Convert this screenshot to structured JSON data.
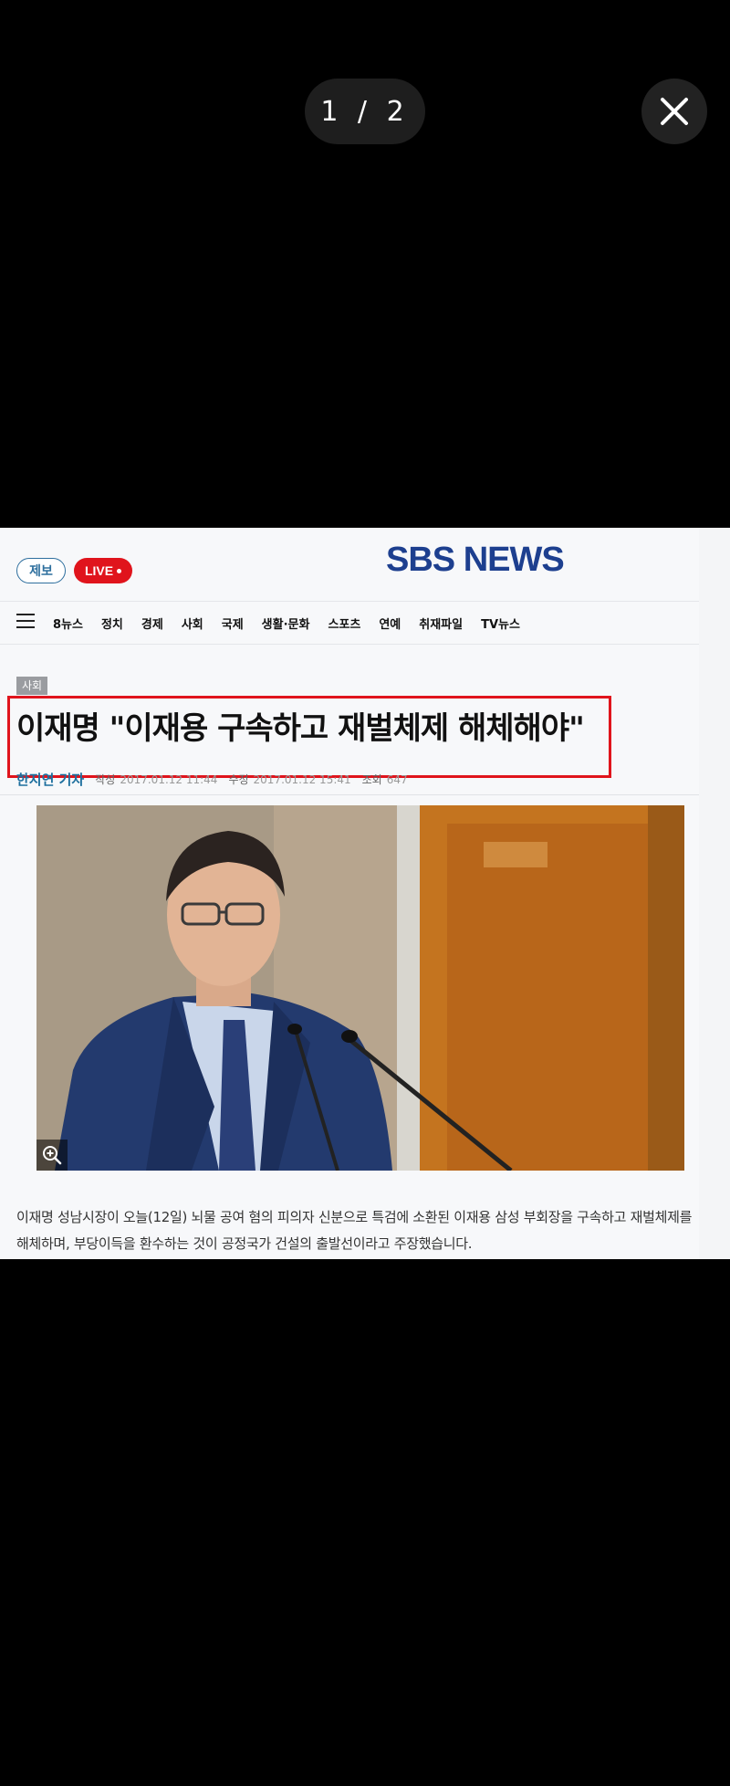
{
  "viewer": {
    "counter_text": "1 / 2",
    "close_label": "close"
  },
  "header": {
    "logo_text": "SBS NEWS",
    "tip_label": "제보",
    "live_label": "LIVE"
  },
  "nav": {
    "items": [
      "8뉴스",
      "정치",
      "경제",
      "사회",
      "국제",
      "생활·문화",
      "스포츠",
      "연예",
      "취재파일",
      "TV뉴스"
    ]
  },
  "article": {
    "category": "사회",
    "headline": "이재명 \"이재용 구속하고 재벌체제 해체해야\"",
    "author": "한지연 기자",
    "written_label": "작성",
    "written_time": "2017.01.12 11:44",
    "modified_label": "수정",
    "modified_time": "2017.01.12 15:41",
    "views_label": "조회",
    "views": "647",
    "body_line1": "이재명 성남시장이 오늘(12일) 뇌물 공여 혐의 피의자 신분으로 특검에 소환된 이재용 삼성 부회장을 구속하고 재벌체제를",
    "body_line2": "해체하며, 부당이득을 환수하는 것이 공정국가 건설의 출발선이라고 주장했습니다."
  },
  "colors": {
    "brand_blue": "#1d3f8f",
    "live_red": "#e0141c",
    "highlight_red": "#e0141c",
    "author_blue": "#1d6f9e"
  }
}
